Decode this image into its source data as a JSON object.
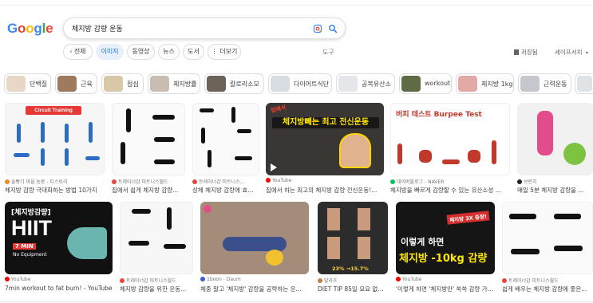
{
  "logo_letters": [
    {
      "ch": "G",
      "color": "#4285F4"
    },
    {
      "ch": "o",
      "color": "#EA4335"
    },
    {
      "ch": "o",
      "color": "#FBBC05"
    },
    {
      "ch": "g",
      "color": "#4285F4"
    },
    {
      "ch": "l",
      "color": "#34A853"
    },
    {
      "ch": "e",
      "color": "#EA4335"
    }
  ],
  "search": {
    "query": "체지방 감량 운동",
    "lens_icon": "google-lens-icon",
    "search_icon": "magnifier-icon"
  },
  "tabs": [
    {
      "label": "전체",
      "active": false
    },
    {
      "label": "이미지",
      "active": true
    },
    {
      "label": "동영상",
      "active": false
    },
    {
      "label": "뉴스",
      "active": false
    },
    {
      "label": "도서",
      "active": false
    },
    {
      "label": "더보기",
      "active": false
    }
  ],
  "tools_label": "도구",
  "saved_label": "저장됨",
  "safesearch_label": "세이프서치",
  "related": [
    {
      "label": "단백질",
      "color": "#e9d7c6"
    },
    {
      "label": "근육",
      "color": "#a07a5f"
    },
    {
      "label": "점심",
      "color": "#d9c8a8"
    },
    {
      "label": "체지방률",
      "color": "#c9bcb0"
    },
    {
      "label": "칼로리소모",
      "color": "#6b6258"
    },
    {
      "label": "다이어트식단",
      "color": "#d8dde3"
    },
    {
      "label": "공복유산소",
      "color": "#e4e6ea"
    },
    {
      "label": "workout",
      "color": "#5f6b45"
    },
    {
      "label": "체지방 1kg",
      "color": "#e3a9a4"
    },
    {
      "label": "근력운동",
      "color": "#c4c7cb"
    },
    {
      "label": "",
      "color": "#dfe3e8"
    }
  ],
  "results": [
    {
      "source": "솔빵기 마을 농봉 - 티스토리",
      "title": "체지방 감량 극대화하는 방법 10가지",
      "dot": "#f08a24",
      "badge": "Circuit Training"
    },
    {
      "source": "트레이너감 피트니스월드",
      "title": "집에서 쉽게 체지방 감량...",
      "dot": "#e8453c"
    },
    {
      "source": "트레이너감 피트니스...",
      "title": "상체 체지방 감량에 효...",
      "dot": "#e8453c"
    },
    {
      "source": "YouTube",
      "title": "집에서 하는 최고의 체지방 감량 전신운동!...",
      "dot": "#ff0000",
      "caption": "체지방빼는 최고 전신운동",
      "tag": "집에서"
    },
    {
      "source": "네이버블로그 - NAVER",
      "title": "체지방을 빠르게 감량할 수 있는 유산소성 ...",
      "dot": "#03c75a",
      "caption": "버피 테스트 Burpee Test"
    },
    {
      "source": "브런치",
      "title": "매일 5분 체지방 감량을 ...",
      "dot": "#222222"
    },
    {
      "source": "YouTube",
      "title": "7min workout to fat burn! - YouTube",
      "dot": "#ff0000",
      "caption_top": "[체지방감량]",
      "caption_main": "HIIT",
      "caption_sub": "7 MIN",
      "caption_sub2": "No Equipment"
    },
    {
      "source": "트레이너감 피트니스월드",
      "title": "체지방 감량을 위한 운동...",
      "dot": "#e8453c"
    },
    {
      "source": "1boon - Daum",
      "title": "체중 말고 '체지방' 감량을 공략하는 운...",
      "dot": "#3b5bdb"
    },
    {
      "source": "탈라츠",
      "title": "DIET TIP 85일 요요 없는...",
      "dot": "#c08040",
      "stats": "23% →15.7%"
    },
    {
      "source": "YouTube",
      "title": "'이렇게 하면 '체지방만' 쏙쏙 감량 가...",
      "dot": "#ff0000",
      "caption_a": "이렇게 하면",
      "caption_b": "체지방 -10kg 감량",
      "caption_c": "체지방 3X 증량!"
    },
    {
      "source": "트레이너감 피트니스월드",
      "title": "쉽게 배우는 체지방 감량에 좋은...",
      "dot": "#e8453c"
    }
  ]
}
